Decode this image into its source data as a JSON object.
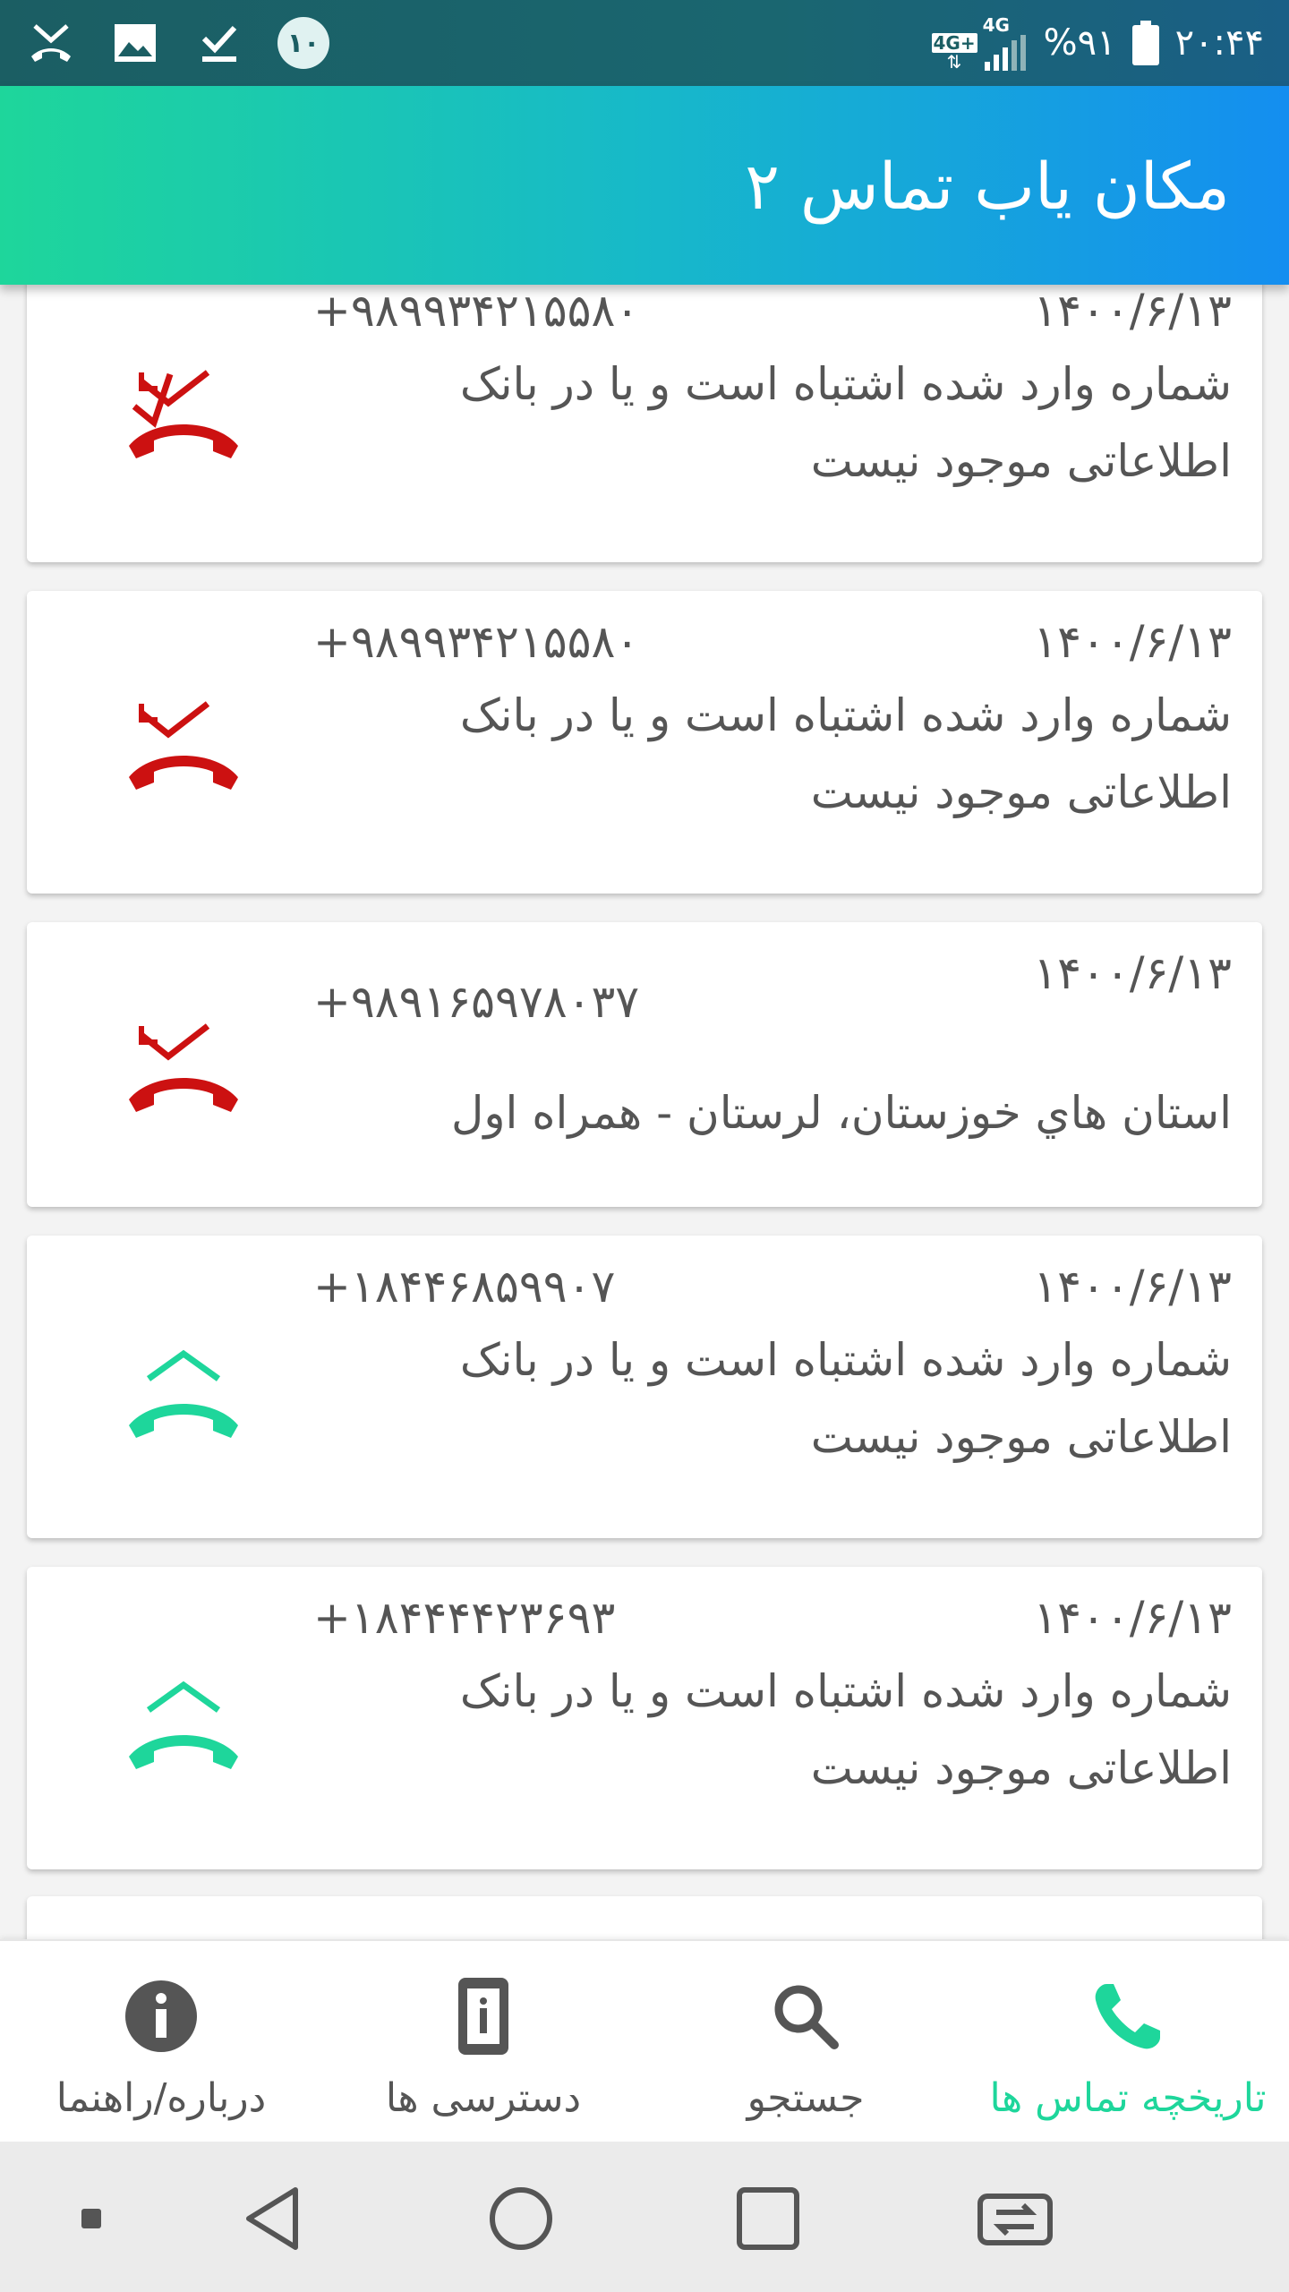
{
  "status_bar": {
    "notification_badge": "۱۰",
    "network_label_top": "4G+",
    "network_label_signal": "4G",
    "battery_percent": "%۹۱",
    "time": "۲۰:۴۴"
  },
  "app_bar": {
    "title": "مکان یاب تماس ۲"
  },
  "calls": [
    {
      "date": "۱۴۰۰/۶/۱۳",
      "number": "+۹۸۹۹۳۴۲۱۵۵۸۰",
      "line1": "شماره وارد شده اشتباه است و یا در بانک",
      "line2": "اطلاعاتی موجود نیست",
      "type_icon": "missed-call-icon"
    },
    {
      "date": "۱۴۰۰/۶/۱۳",
      "number": "+۹۸۹۹۳۴۲۱۵۵۸۰",
      "line1": "شماره وارد شده اشتباه است و یا در بانک",
      "line2": "اطلاعاتی موجود نیست",
      "type_icon": "missed-call-icon"
    },
    {
      "date": "۱۴۰۰/۶/۱۳",
      "number": "+۹۸۹۱۶۵۹۷۸۰۳۷",
      "line1": "استان هاي خوزستان، لرستان - همراه اول",
      "line2": "",
      "type_icon": "missed-call-icon"
    },
    {
      "date": "۱۴۰۰/۶/۱۳",
      "number": "+۱۸۴۴۶۸۵۹۹۰۷",
      "line1": "شماره وارد شده اشتباه است و یا در بانک",
      "line2": "اطلاعاتی موجود نیست",
      "type_icon": "outgoing-call-icon"
    },
    {
      "date": "۱۴۰۰/۶/۱۳",
      "number": "+۱۸۴۴۴۴۲۳۶۹۳",
      "line1": "شماره وارد شده اشتباه است و یا در بانک",
      "line2": "اطلاعاتی موجود نیست",
      "type_icon": "outgoing-call-icon"
    }
  ],
  "bottom_nav": {
    "about": "درباره/راهنما",
    "permissions": "دسترسی ها",
    "search": "جستجو",
    "call_history": "تاریخچه تماس ها"
  },
  "colors": {
    "accent": "#1ed69b",
    "missed": "#cc1111",
    "text": "#555555"
  }
}
